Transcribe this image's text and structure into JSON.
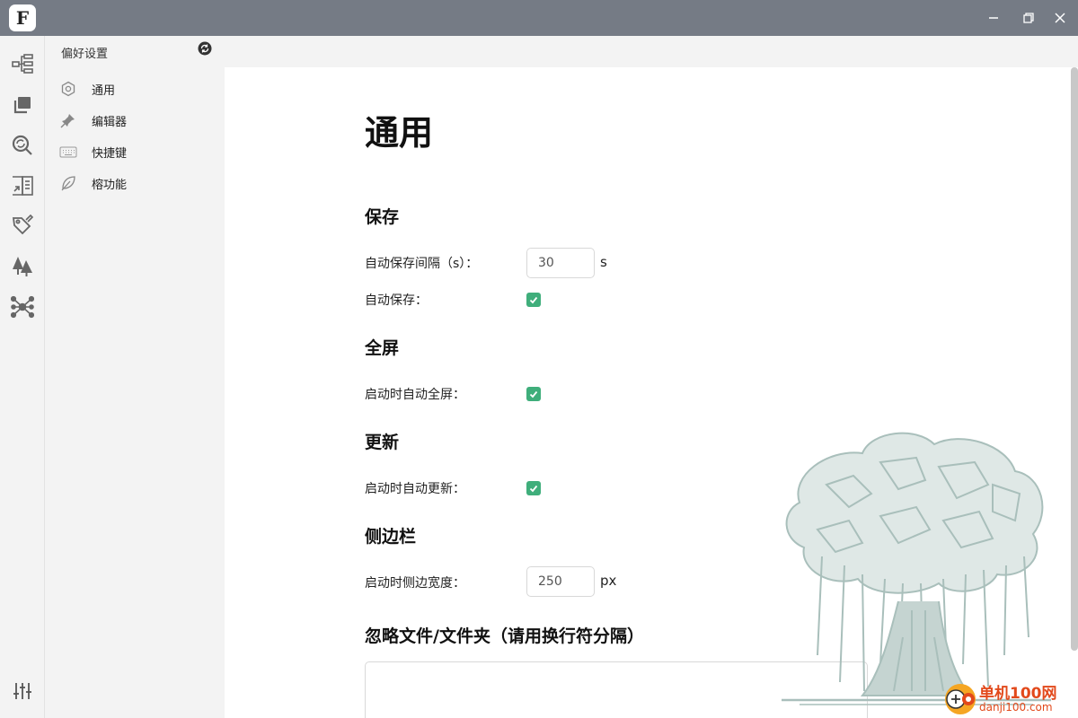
{
  "titlebar": {
    "logo_letter": "F",
    "controls": [
      "minimize",
      "restore",
      "close"
    ]
  },
  "activitybar": {
    "icons": [
      "outline-tree-icon",
      "files-icon",
      "search-refresh-icon",
      "reading-list-icon",
      "tag-edit-icon",
      "forest-icon",
      "graph-network-icon"
    ],
    "bottom_icon": "settings-sliders-icon"
  },
  "sidebar": {
    "title": "偏好设置",
    "items": [
      {
        "label": "通用",
        "icon": "gear-hexagon-icon"
      },
      {
        "label": "编辑器",
        "icon": "pin-icon"
      },
      {
        "label": "快捷键",
        "icon": "keyboard-icon"
      },
      {
        "label": "榕功能",
        "icon": "leaf-icon"
      }
    ]
  },
  "main": {
    "title": "通用",
    "sections": {
      "save": {
        "heading": "保存",
        "interval_label": "自动保存间隔（s）：",
        "interval_value": "30",
        "interval_unit": "s",
        "auto_save_label": "自动保存：",
        "auto_save_checked": true
      },
      "fullscreen": {
        "heading": "全屏",
        "label": "启动时自动全屏：",
        "checked": true
      },
      "update": {
        "heading": "更新",
        "label": "启动时自动更新：",
        "checked": true
      },
      "sidebar": {
        "heading": "侧边栏",
        "label": "启动时侧边宽度：",
        "value": "250",
        "unit": "px"
      },
      "ignore": {
        "heading": "忽略文件/文件夹（请用换行符分隔）",
        "value": ""
      }
    }
  },
  "watermark": {
    "line1": "单机100网",
    "line2": "danji100.com"
  },
  "colors": {
    "titlebar": "#757b85",
    "checkbox": "#3fae7b",
    "panel": "#f3f3f3",
    "watermark": "#e2491b",
    "tree": "#a9bfbb"
  }
}
